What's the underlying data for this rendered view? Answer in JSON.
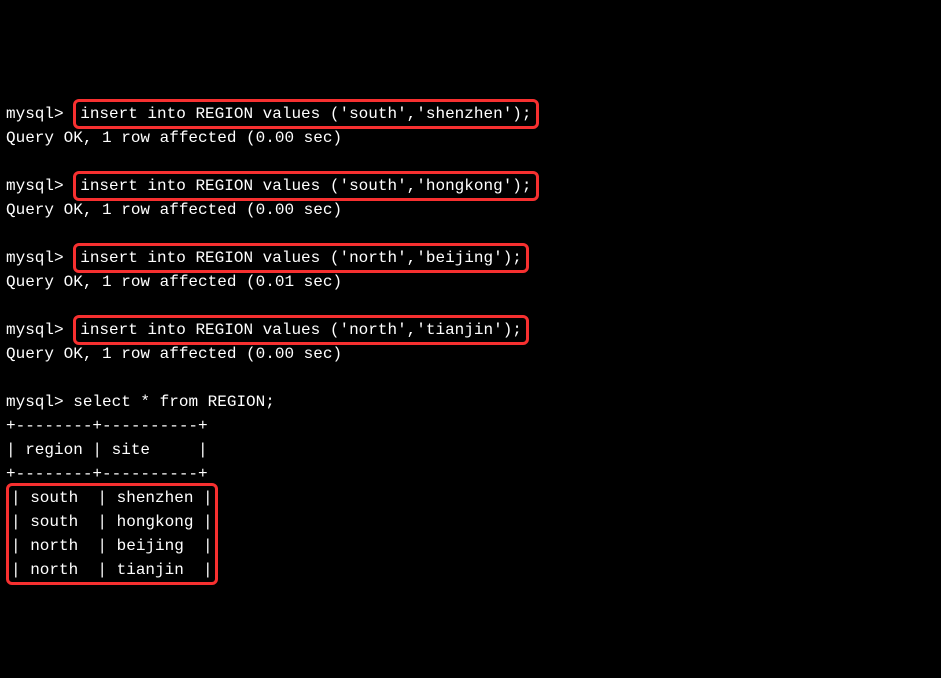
{
  "prompt": "mysql>",
  "commands": [
    {
      "command": "insert into REGION values ('south','shenzhen');",
      "result": "Query OK, 1 row affected (0.00 sec)"
    },
    {
      "command": "insert into REGION values ('south','hongkong');",
      "result": "Query OK, 1 row affected (0.00 sec)"
    },
    {
      "command": "insert into REGION values ('north','beijing');",
      "result": "Query OK, 1 row affected (0.01 sec)"
    },
    {
      "command": "insert into REGION values ('north','tianjin');",
      "result": "Query OK, 1 row affected (0.00 sec)"
    }
  ],
  "select_command": "select * from REGION;",
  "table": {
    "border_top": "+--------+----------+",
    "header": "| region | site     |",
    "border_mid": "+--------+----------+",
    "rows": [
      "| south  | shenzhen |",
      "| south  | hongkong |",
      "| north  | beijing  |",
      "| north  | tianjin  |"
    ]
  }
}
